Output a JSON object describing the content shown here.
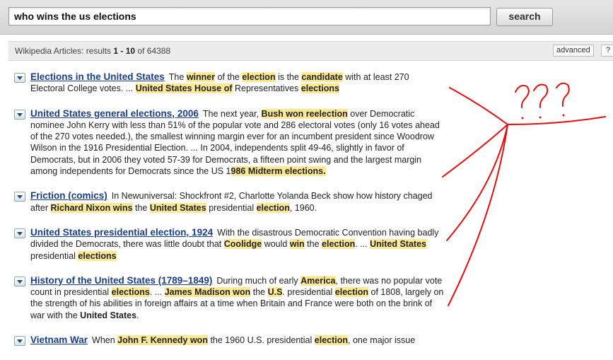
{
  "search": {
    "query": "who wins the us elections",
    "button_label": "search"
  },
  "results_bar": {
    "prefix": "Wikipedia Articles: results ",
    "range_start": "1",
    "range_sep": " - ",
    "range_end": "10",
    "of_label": " of ",
    "total": "64388",
    "advanced_label": "advanced",
    "help_label": "?"
  },
  "results": [
    {
      "title": "Elections in the United States",
      "snippet": [
        {
          "t": "The "
        },
        {
          "t": "winner",
          "h": true
        },
        {
          "t": " of the "
        },
        {
          "t": "election",
          "h": true
        },
        {
          "t": " is the "
        },
        {
          "t": "candidate",
          "h": true
        },
        {
          "t": " with at least 270 Electoral College votes. ... "
        },
        {
          "t": "United States House of",
          "h": true
        },
        {
          "t": " Representatives "
        },
        {
          "t": "elections",
          "h": true
        }
      ]
    },
    {
      "title": "United States general elections, 2006",
      "snippet": [
        {
          "t": "The next year, "
        },
        {
          "t": "Bush won reelection",
          "h": true
        },
        {
          "t": " over Democratic nominee John Kerry with less than 51% of the popular vote and 286 electoral votes (only 16 votes ahead of the 270 votes needed.), the smallest winning margin ever for an incumbent president since Woodrow Wilson in the 1916 Presidential Election. ... In 2004, independents split 49-46, slightly in favor of Democrats, but in 2006 they voted 57-39 for Democrats, a fifteen point swing and the largest margin among independents for Democrats since the US 1"
        },
        {
          "t": "986 Midterm e",
          "h": true
        },
        {
          "t": "lections.",
          "h": true
        }
      ]
    },
    {
      "title": "Friction (comics)",
      "snippet": [
        {
          "t": "In Newuniversal: Shockfront #2, Charlotte Yolanda Beck show how history chaged after "
        },
        {
          "t": "Richard Nixon wins",
          "h": true
        },
        {
          "t": " the "
        },
        {
          "t": "United States",
          "h": true
        },
        {
          "t": " presidential "
        },
        {
          "t": "election",
          "h": true
        },
        {
          "t": ", 1960."
        }
      ]
    },
    {
      "title": "United States presidential election, 1924",
      "snippet": [
        {
          "t": "With the disastrous Democratic Convention having badly divided the Democrats, there was little doubt that "
        },
        {
          "t": "Coolidge",
          "h": true
        },
        {
          "t": " would "
        },
        {
          "t": "win",
          "h": true
        },
        {
          "t": " the "
        },
        {
          "t": "election",
          "h": true
        },
        {
          "t": ". ... "
        },
        {
          "t": "United States",
          "h": true
        },
        {
          "t": " presidential "
        },
        {
          "t": "elections",
          "h": true
        }
      ]
    },
    {
      "title": "History of the United States (1789–1849)",
      "snippet": [
        {
          "t": "During much of early "
        },
        {
          "t": "America",
          "h": true
        },
        {
          "t": ", there was no popular vote count in presidential "
        },
        {
          "t": "elections",
          "h": true
        },
        {
          "t": ". ... "
        },
        {
          "t": "James Madison won",
          "h": true
        },
        {
          "t": " the "
        },
        {
          "t": "U.S",
          "h": true
        },
        {
          "t": ". presidential "
        },
        {
          "t": "election",
          "h": true
        },
        {
          "t": " of 1808, largely on the strength of his abilities in foreign affairs at a time when Britain and France were both on the brink of war with the "
        },
        {
          "t": "United States",
          "b": true
        },
        {
          "t": "."
        }
      ]
    },
    {
      "title": "Vietnam War",
      "snippet": [
        {
          "t": "When "
        },
        {
          "t": "John F. Kennedy won",
          "h": true
        },
        {
          "t": " the 1960 U.S. presidential "
        },
        {
          "t": "election",
          "h": true
        },
        {
          "t": ", one major issue"
        }
      ]
    }
  ],
  "annotation": {
    "text": "???",
    "color": "#e01010"
  },
  "colors": {
    "highlight": "#fde895",
    "link": "#1a3e86"
  }
}
